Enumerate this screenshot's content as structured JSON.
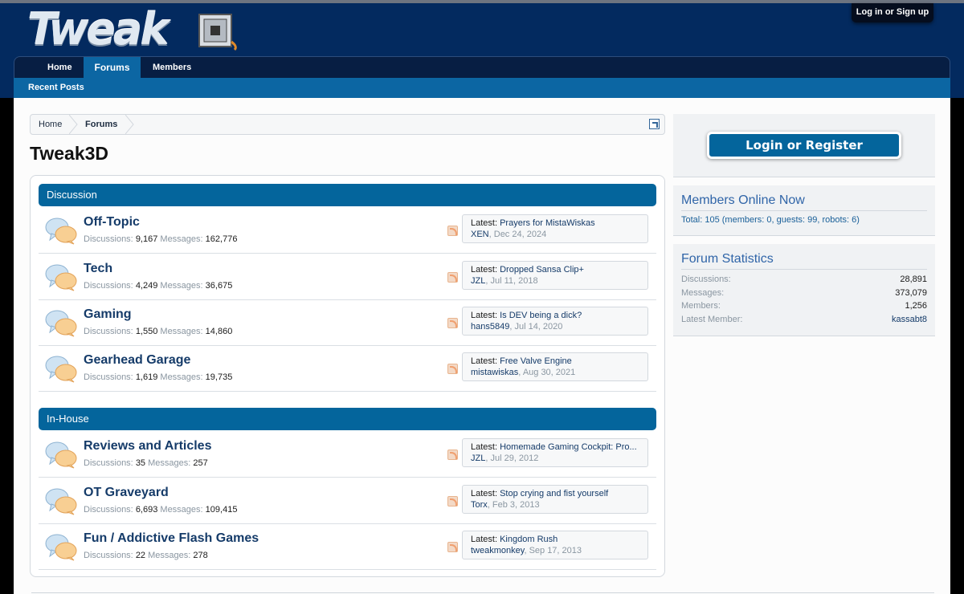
{
  "header": {
    "logo_text": "Tweak",
    "login_link": "Log in or Sign up"
  },
  "nav": {
    "tabs": [
      {
        "label": "Home"
      },
      {
        "label": "Forums"
      },
      {
        "label": "Members"
      }
    ],
    "active_tab": "Forums",
    "subnav": {
      "recent_posts": "Recent Posts"
    }
  },
  "breadcrumb": [
    {
      "label": "Home"
    },
    {
      "label": "Forums"
    }
  ],
  "page_title": "Tweak3D",
  "categories": [
    {
      "title": "Discussion",
      "nodes": [
        {
          "title": "Off-Topic",
          "discussions": "9,167",
          "messages": "162,776",
          "latest_title": "Prayers for MistaWiskas",
          "latest_user": "XEN",
          "latest_date": "Dec 24, 2024"
        },
        {
          "title": "Tech",
          "discussions": "4,249",
          "messages": "36,675",
          "latest_title": "Dropped Sansa Clip+",
          "latest_user": "JZL",
          "latest_date": "Jul 11, 2018"
        },
        {
          "title": "Gaming",
          "discussions": "1,550",
          "messages": "14,860",
          "latest_title": "Is DEV being a dick?",
          "latest_user": "hans5849",
          "latest_date": "Jul 14, 2020"
        },
        {
          "title": "Gearhead Garage",
          "discussions": "1,619",
          "messages": "19,735",
          "latest_title": "Free Valve Engine",
          "latest_user": "mistawiskas",
          "latest_date": "Aug 30, 2021"
        }
      ]
    },
    {
      "title": "In-House",
      "nodes": [
        {
          "title": "Reviews and Articles",
          "discussions": "35",
          "messages": "257",
          "latest_title": "Homemade Gaming Cockpit: Pro...",
          "latest_user": "JZL",
          "latest_date": "Jul 29, 2012"
        },
        {
          "title": "OT Graveyard",
          "discussions": "6,693",
          "messages": "109,415",
          "latest_title": "Stop crying and fist yourself",
          "latest_user": "Torx",
          "latest_date": "Feb 3, 2013"
        },
        {
          "title": "Fun / Addictive Flash Games",
          "discussions": "22",
          "messages": "278",
          "latest_title": "Kingdom Rush",
          "latest_user": "tweakmonkey",
          "latest_date": "Sep 17, 2013"
        }
      ]
    }
  ],
  "labels": {
    "discussions": "Discussions:",
    "messages": "Messages:",
    "latest": "Latest:"
  },
  "sidebar": {
    "login_button": "Login or Register",
    "members_online": {
      "title": "Members Online Now",
      "total_line": "Total: 105 (members: 0, guests: 99, robots: 6)"
    },
    "forum_stats": {
      "title": "Forum Statistics",
      "rows": [
        {
          "label": "Discussions:",
          "value": "28,891"
        },
        {
          "label": "Messages:",
          "value": "373,079"
        },
        {
          "label": "Members:",
          "value": "1,256"
        },
        {
          "label": "Latest Member:",
          "value": "kassabt8"
        }
      ]
    }
  }
}
